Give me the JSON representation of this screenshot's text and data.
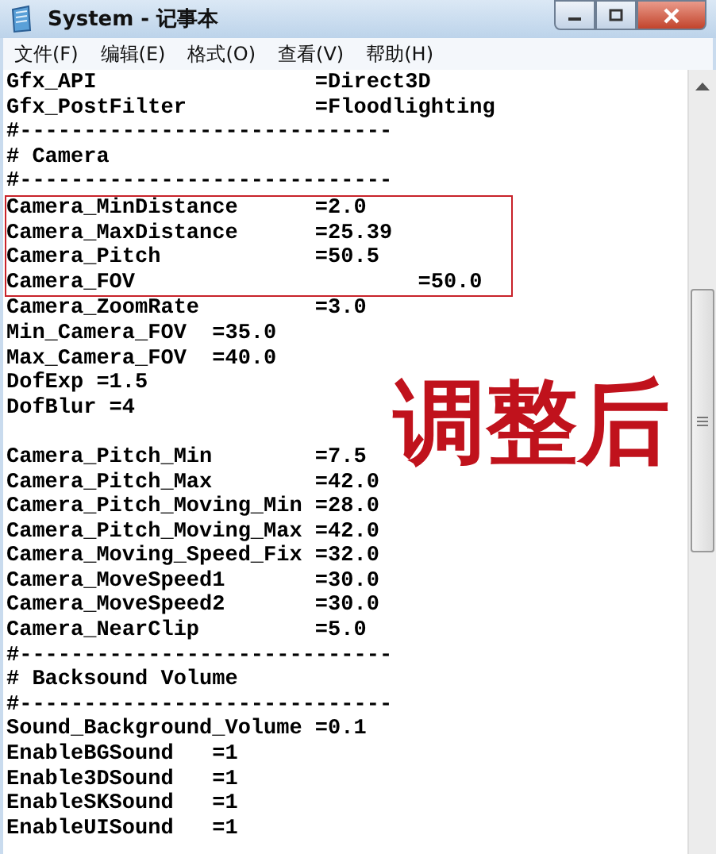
{
  "window": {
    "title": "System - 记事本"
  },
  "menu": [
    "文件(F)",
    "编辑(E)",
    "格式(O)",
    "查看(V)",
    "帮助(H)"
  ],
  "lines": [
    {
      "kind": "text",
      "text": "Gfx_API                 =Direct3D",
      "boxed": false
    },
    {
      "kind": "text",
      "text": "Gfx_PostFilter          =Floodlighting",
      "boxed": false
    },
    {
      "kind": "text",
      "text": "#-----------------------------",
      "boxed": false
    },
    {
      "kind": "text",
      "text": "# Camera",
      "boxed": false
    },
    {
      "kind": "text",
      "text": "#-----------------------------",
      "boxed": false
    },
    {
      "kind": "text",
      "text": "Camera_MinDistance      =2.0",
      "boxed": true
    },
    {
      "kind": "text",
      "text": "Camera_MaxDistance      =25.39",
      "boxed": true
    },
    {
      "kind": "text",
      "text": "Camera_Pitch            =50.5",
      "boxed": true
    },
    {
      "kind": "text",
      "text": "Camera_FOV                      =50.0",
      "boxed": true
    },
    {
      "kind": "text",
      "text": "Camera_ZoomRate         =3.0",
      "boxed": false
    },
    {
      "kind": "text",
      "text": "Min_Camera_FOV  =35.0",
      "boxed": false
    },
    {
      "kind": "text",
      "text": "Max_Camera_FOV  =40.0",
      "boxed": false
    },
    {
      "kind": "text",
      "text": "DofExp =1.5",
      "boxed": false
    },
    {
      "kind": "text",
      "text": "DofBlur =4",
      "boxed": false
    },
    {
      "kind": "blank"
    },
    {
      "kind": "text",
      "text": "Camera_Pitch_Min        =7.5",
      "boxed": false
    },
    {
      "kind": "text",
      "text": "Camera_Pitch_Max        =42.0",
      "boxed": false
    },
    {
      "kind": "text",
      "text": "Camera_Pitch_Moving_Min =28.0",
      "boxed": false
    },
    {
      "kind": "text",
      "text": "Camera_Pitch_Moving_Max =42.0",
      "boxed": false
    },
    {
      "kind": "text",
      "text": "Camera_Moving_Speed_Fix =32.0",
      "boxed": false
    },
    {
      "kind": "text",
      "text": "Camera_MoveSpeed1       =30.0",
      "boxed": false
    },
    {
      "kind": "text",
      "text": "Camera_MoveSpeed2       =30.0",
      "boxed": false
    },
    {
      "kind": "text",
      "text": "Camera_NearClip         =5.0",
      "boxed": false
    },
    {
      "kind": "text",
      "text": "#-----------------------------",
      "boxed": false
    },
    {
      "kind": "text",
      "text": "# Backsound Volume",
      "boxed": false
    },
    {
      "kind": "text",
      "text": "#-----------------------------",
      "boxed": false
    },
    {
      "kind": "text",
      "text": "Sound_Background_Volume =0.1",
      "boxed": false
    },
    {
      "kind": "text",
      "text": "EnableBGSound   =1",
      "boxed": false
    },
    {
      "kind": "text",
      "text": "Enable3DSound   =1",
      "boxed": false
    },
    {
      "kind": "text",
      "text": "EnableSKSound   =1",
      "boxed": false
    },
    {
      "kind": "text",
      "text": "EnableUISound   =1",
      "boxed": false
    }
  ],
  "overlay_text": "调整后"
}
